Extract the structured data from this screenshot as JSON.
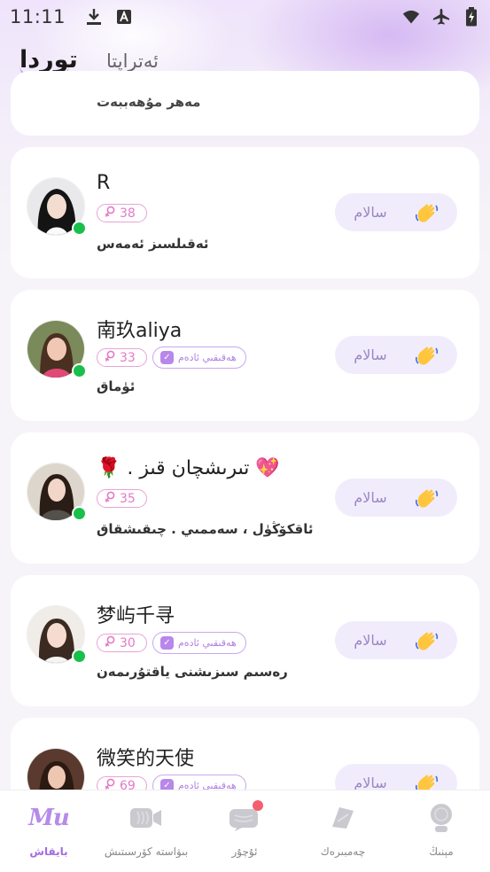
{
  "status_bar": {
    "time": "11:11",
    "left_icons": [
      "download-icon",
      "font-a-icon"
    ],
    "right_icons": [
      "wifi-icon",
      "airplane-icon",
      "battery-icon"
    ]
  },
  "header": {
    "active_tab": "توردا",
    "inactive_tab": "ئەتراپتا"
  },
  "partial_card": {
    "bio": "مەھر مۇھەببەت"
  },
  "users": [
    {
      "name": "R",
      "age": "38",
      "verified": false,
      "verified_label": "",
      "bio": "ئەقىلسىز ئەمەس",
      "online": true,
      "hello_label": "سالام"
    },
    {
      "name": "南玖aliya",
      "age": "33",
      "verified": true,
      "verified_label": "ھەقىقىي ئادەم",
      "bio": "ئۈماق",
      "online": true,
      "hello_label": "سالام"
    },
    {
      "name": "🌹 . تىرىشچان قىز 💖",
      "age": "35",
      "verified": false,
      "verified_label": "",
      "bio": "ئاقكۆڭۈل ، سەممىي . چىقىشقاق",
      "online": true,
      "hello_label": "سالام"
    },
    {
      "name": "梦屿千寻",
      "age": "30",
      "verified": true,
      "verified_label": "ھەقىقىي ئادەم",
      "bio": "رەسىم سىزىشنى ياقتۇرىمەن",
      "online": true,
      "hello_label": "سالام"
    },
    {
      "name": "微笑的天使",
      "age": "69",
      "verified": true,
      "verified_label": "ھەقىقىي ئادەم",
      "bio": "",
      "online": false,
      "hello_label": "سالام"
    }
  ],
  "bottom_nav": [
    {
      "label": "بايقاش",
      "icon": "mu-logo-icon",
      "active": true,
      "logo_text": "Mu"
    },
    {
      "label": "بىۋاستە كۆرسىتىش",
      "icon": "video-camera-icon",
      "active": false
    },
    {
      "label": "ئۇچۇر",
      "icon": "chat-bubble-icon",
      "active": false,
      "has_badge": true
    },
    {
      "label": "چەمبىرەك",
      "icon": "compass-icon",
      "active": false
    },
    {
      "label": "مېنىڭ",
      "icon": "profile-icon",
      "active": false
    }
  ],
  "colors": {
    "accent": "#b68be8",
    "online": "#18c04b",
    "age_tag": "#e47ac6",
    "badge": "#f35f6f"
  }
}
